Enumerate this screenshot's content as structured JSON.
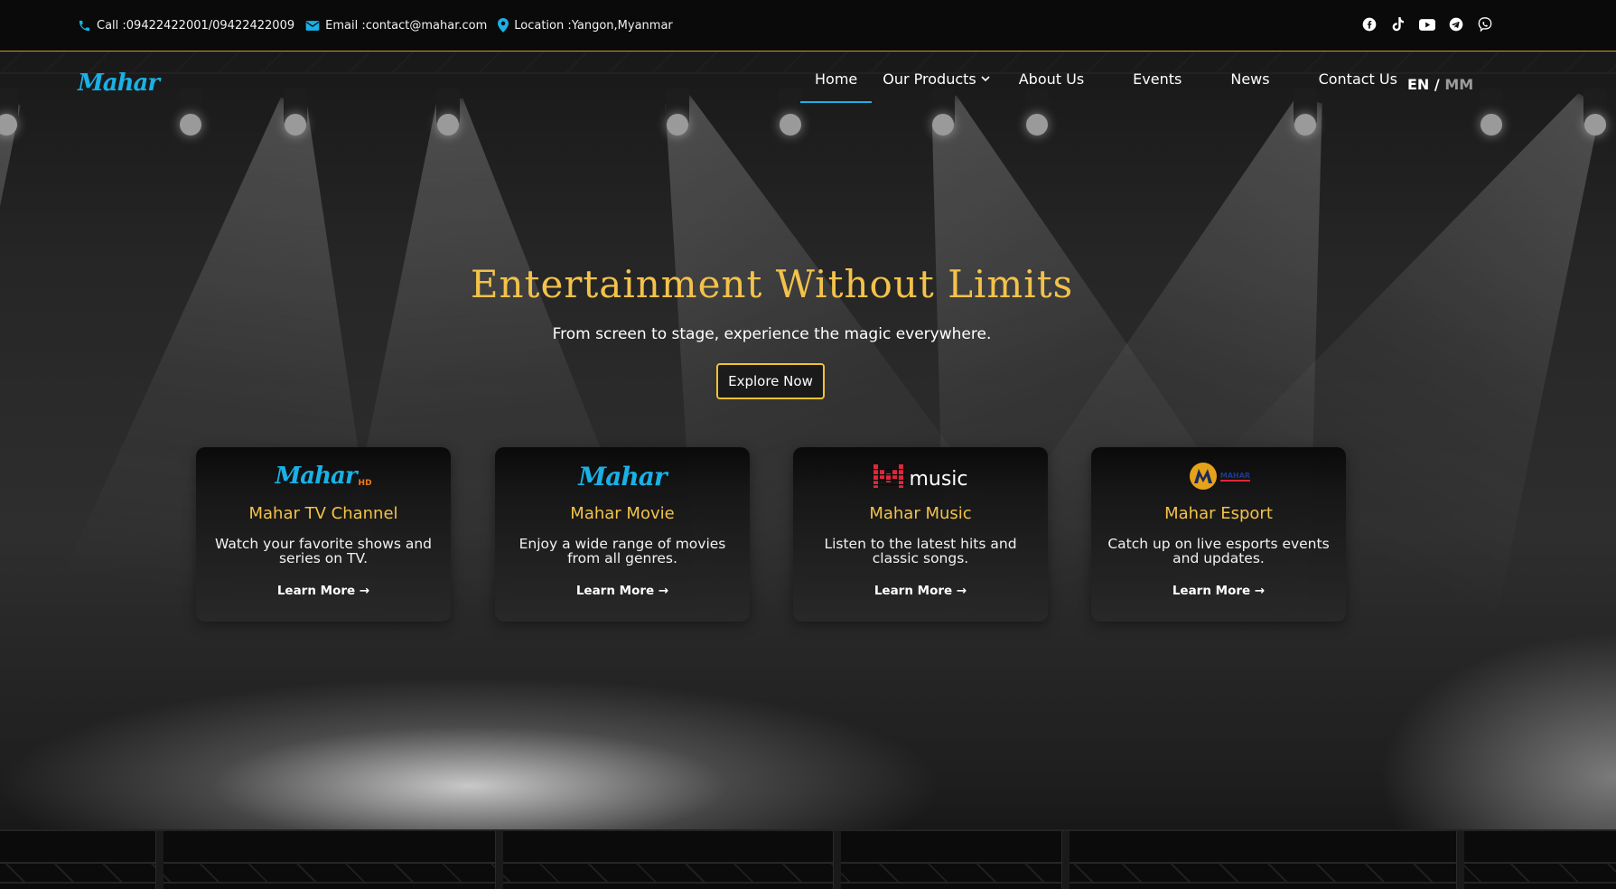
{
  "topbar": {
    "call": "Call :09422422001/09422422009",
    "email": "Email :contact@mahar.com",
    "location": "Location :Yangon,Myanmar",
    "socials": [
      "facebook-icon",
      "tiktok-icon",
      "youtube-icon",
      "telegram-icon",
      "viber-icon"
    ]
  },
  "nav": {
    "logo": "Mahar",
    "items": [
      "Home",
      "Our Products",
      "About Us",
      "Events",
      "News",
      "Contact Us"
    ],
    "lang_en": "EN /",
    "lang_mm": "MM"
  },
  "hero": {
    "title": "Entertainment Without Limits",
    "subtitle": "From screen to stage, experience the magic everywhere.",
    "cta": "Explore Now"
  },
  "cards": [
    {
      "title": "Mahar TV Channel",
      "desc": "Watch your favorite shows and series on TV.",
      "more": "Learn More →",
      "logo_text": "Mahar",
      "logo_tag": "HD"
    },
    {
      "title": "Mahar Movie",
      "desc": "Enjoy a wide range of movies from all genres.",
      "more": "Learn More →",
      "logo_text": "Mahar"
    },
    {
      "title": "Mahar Music",
      "desc": "Listen to the latest hits and classic songs.",
      "more": "Learn More →",
      "logo_text": "music"
    },
    {
      "title": "Mahar Esport",
      "desc": "Catch up on live esports events and updates.",
      "more": "Learn More →",
      "logo_text": "MAHAR"
    }
  ],
  "colors": {
    "accent": "#f3c24a",
    "brand_blue": "#19b1e6",
    "button_border": "#f1c233",
    "music_red": "#e0263a"
  }
}
